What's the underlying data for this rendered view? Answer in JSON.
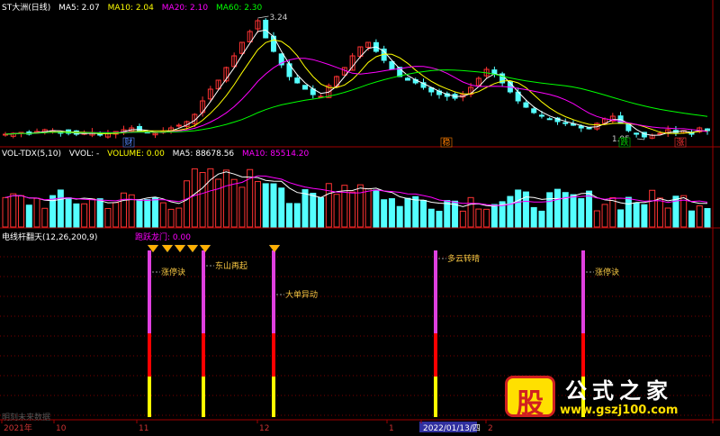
{
  "colors": {
    "background": "#000000",
    "up": "#ff3333",
    "down": "#54ffff",
    "ma5": "#ffffff",
    "ma10": "#ffff00",
    "ma20": "#ff00ff",
    "ma60": "#00ff00",
    "grid": "#7a0000",
    "signal_purple": "#e040e0",
    "signal_red": "#ff0000",
    "signal_yellow": "#ffff00",
    "diamond": "#ffb000",
    "label_gold": "#f5c542",
    "date_highlight_bg": "#3030a0"
  },
  "price_panel": {
    "title": "ST大洲(日线)",
    "ma5_label": "MA5: 2.07",
    "ma10_label": "MA10: 2.04",
    "ma20_label": "MA20: 2.10",
    "ma60_label": "MA60: 2.30",
    "high_label": "3.24",
    "low_label": "1.95",
    "event_markers": [
      {
        "text": "财",
        "color": "#5588ff"
      },
      {
        "text": "稳",
        "color": "#ff7f00"
      },
      {
        "text": "跌",
        "color": "#00cc00"
      },
      {
        "text": "涨",
        "color": "#ff3333"
      }
    ]
  },
  "volume_panel": {
    "title": "VOL-TDX(5,10)",
    "vvol_label": "VVOL: -",
    "volume_label": "VOLUME: 0.00",
    "ma5_label": "MA5: 88678.56",
    "ma10_label": "MA10: 85514.20"
  },
  "indicator_panel": {
    "title": "电线杆翻天(12,26,200,9)",
    "flag_label": "跑跃龙门: 0.00",
    "watermark": "明刻未来数据"
  },
  "signals": [
    {
      "label": "涨停诀"
    },
    {
      "label": "东山再起"
    },
    {
      "label": "大单异动"
    },
    {
      "label": "多云转晴"
    },
    {
      "label": "涨停诀"
    }
  ],
  "x_axis": {
    "labels": [
      "2021年",
      "10",
      "11",
      "12",
      "1",
      "2022/01/13/四",
      "2"
    ]
  },
  "logo": {
    "badge_text": "股",
    "name": "公式之家",
    "url": "www.gszj100.com"
  },
  "chart_data": {
    "type": "candlestick",
    "price_high": 3.24,
    "price_low": 1.95,
    "price_series_approx": [
      1.98,
      1.99,
      2.0,
      1.98,
      2.01,
      2.03,
      2.02,
      2.0,
      1.99,
      1.98,
      1.99,
      2.0,
      1.97,
      1.99,
      2.01,
      2.03,
      2.05,
      2.02,
      2.0,
      1.99,
      2.01,
      2.05,
      2.08,
      2.12,
      2.2,
      2.35,
      2.48,
      2.58,
      2.72,
      2.85,
      3.0,
      3.12,
      3.24,
      3.05,
      2.9,
      2.75,
      2.62,
      2.55,
      2.48,
      2.42,
      2.4,
      2.52,
      2.62,
      2.72,
      2.85,
      2.95,
      3.0,
      2.9,
      2.8,
      2.7,
      2.62,
      2.58,
      2.55,
      2.5,
      2.45,
      2.42,
      2.4,
      2.38,
      2.42,
      2.5,
      2.6,
      2.7,
      2.65,
      2.55,
      2.45,
      2.35,
      2.28,
      2.22,
      2.18,
      2.15,
      2.12,
      2.1,
      2.08,
      2.05,
      2.04,
      2.1,
      2.15,
      2.18,
      2.1,
      2.02,
      1.98,
      1.95,
      1.97,
      1.99,
      2.03,
      2.0,
      2.02,
      1.98,
      2.05,
      2.02
    ],
    "series": [
      {
        "name": "MA5",
        "value": 2.07
      },
      {
        "name": "MA10",
        "value": 2.04
      },
      {
        "name": "MA20",
        "value": 2.1
      },
      {
        "name": "MA60",
        "value": 2.3
      }
    ],
    "volume_ma5": 88678.56,
    "volume_ma10": 85514.2,
    "signal_days": [
      {
        "label": "涨停诀",
        "x_category": "11"
      },
      {
        "label": "东山再起",
        "x_category": "11"
      },
      {
        "label": "大单异动",
        "x_category": "12"
      },
      {
        "label": "多云转晴",
        "x_category": "1"
      },
      {
        "label": "涨停诀",
        "x_category": "2"
      }
    ]
  }
}
